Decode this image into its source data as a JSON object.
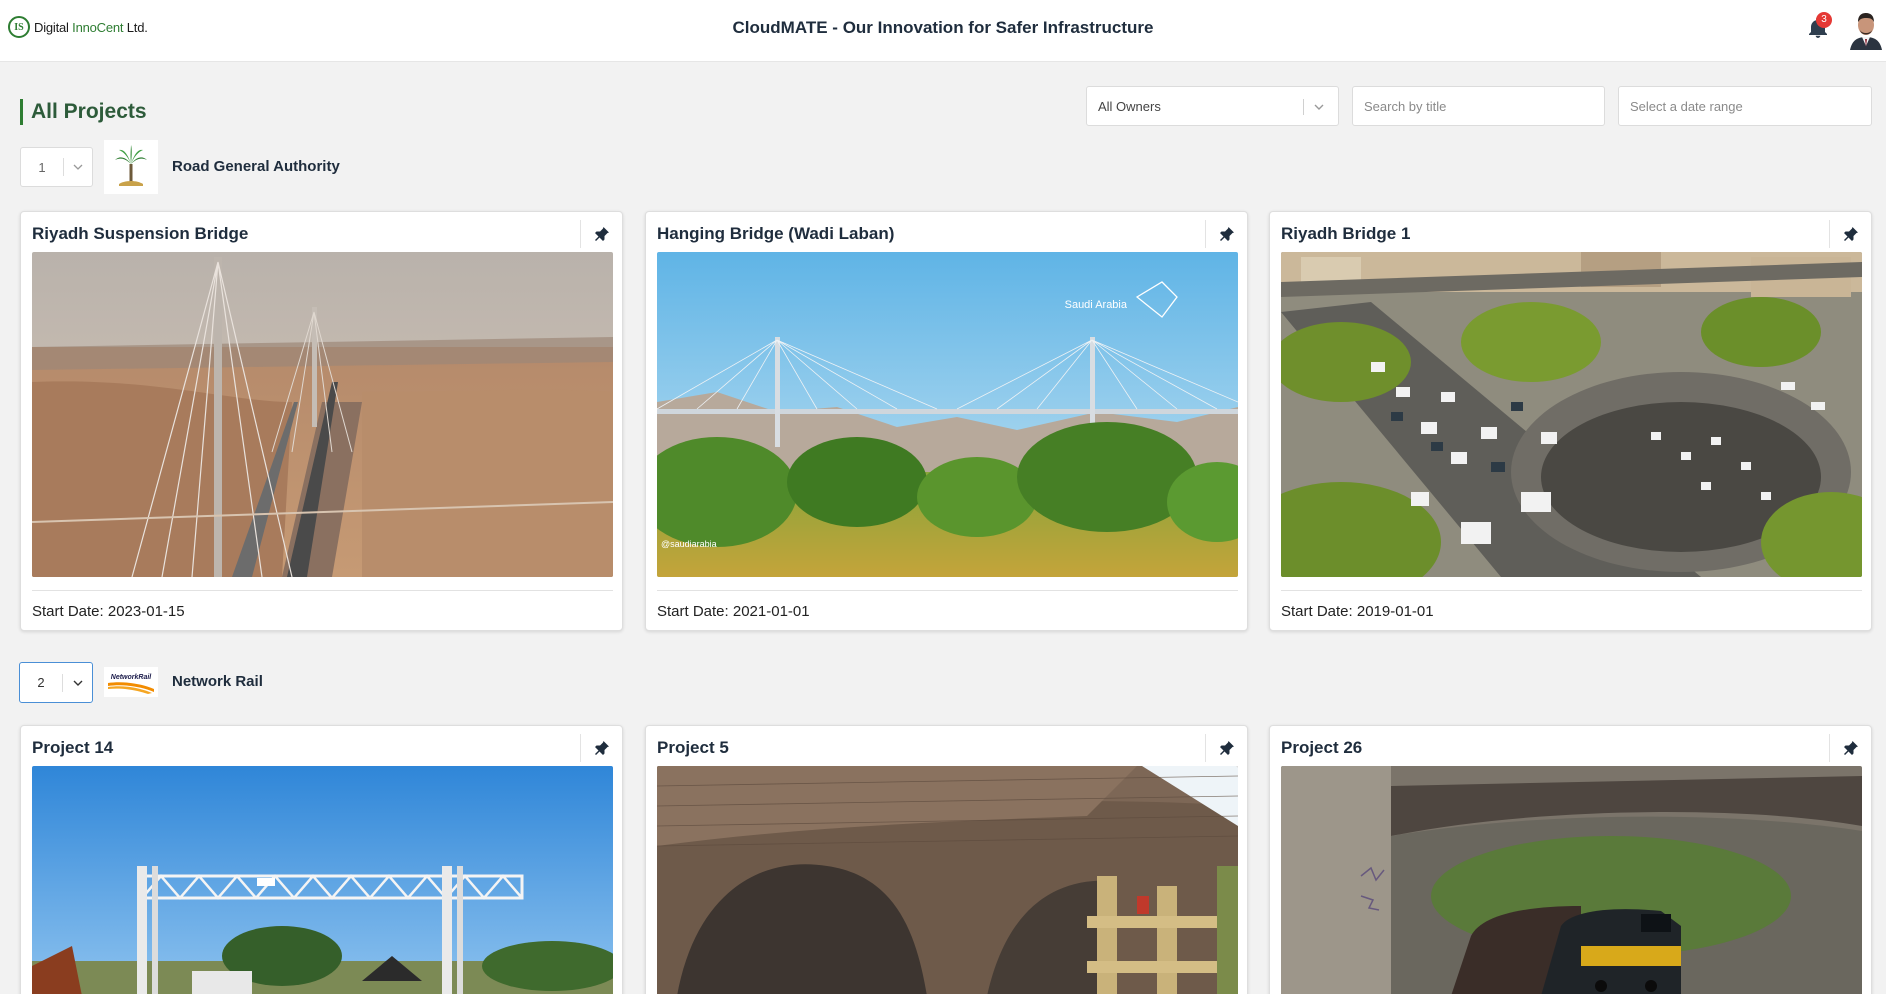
{
  "header": {
    "logo_text_1": "Digital",
    "logo_text_2": "InnoCent",
    "logo_text_3": "Ltd.",
    "logo_mark": "IS",
    "app_title": "CloudMATE - Our Innovation for Safer Infrastructure",
    "notification_count": "3",
    "notification_icon": "bell-icon",
    "avatar_icon": "user-avatar"
  },
  "page": {
    "title": "All Projects"
  },
  "filters": {
    "owner_selected": "All Owners",
    "search_placeholder": "Search by title",
    "date_placeholder": "Select a date range"
  },
  "owners": [
    {
      "page_number": "1",
      "name": "Road General Authority",
      "logo_icon": "palm-tree-logo",
      "projects": [
        {
          "title": "Riyadh Suspension Bridge",
          "start_date": "Start Date: 2023-01-15"
        },
        {
          "title": "Hanging Bridge (Wadi Laban)",
          "start_date": "Start Date: 2021-01-01",
          "image_caption": "Saudi Arabia",
          "image_credit": "@saudiarabia"
        },
        {
          "title": "Riyadh Bridge 1",
          "start_date": "Start Date: 2019-01-01"
        }
      ]
    },
    {
      "page_number": "2",
      "name": "Network Rail",
      "logo_icon": "network-rail-logo",
      "logo_text": "NetworkRail",
      "projects": [
        {
          "title": "Project 14"
        },
        {
          "title": "Project 5"
        },
        {
          "title": "Project 26"
        }
      ]
    }
  ],
  "colors": {
    "accent_green": "#2e7d32",
    "title_green": "#2d5b3a",
    "badge_red": "#e53935",
    "active_border": "#4a8fd6"
  }
}
